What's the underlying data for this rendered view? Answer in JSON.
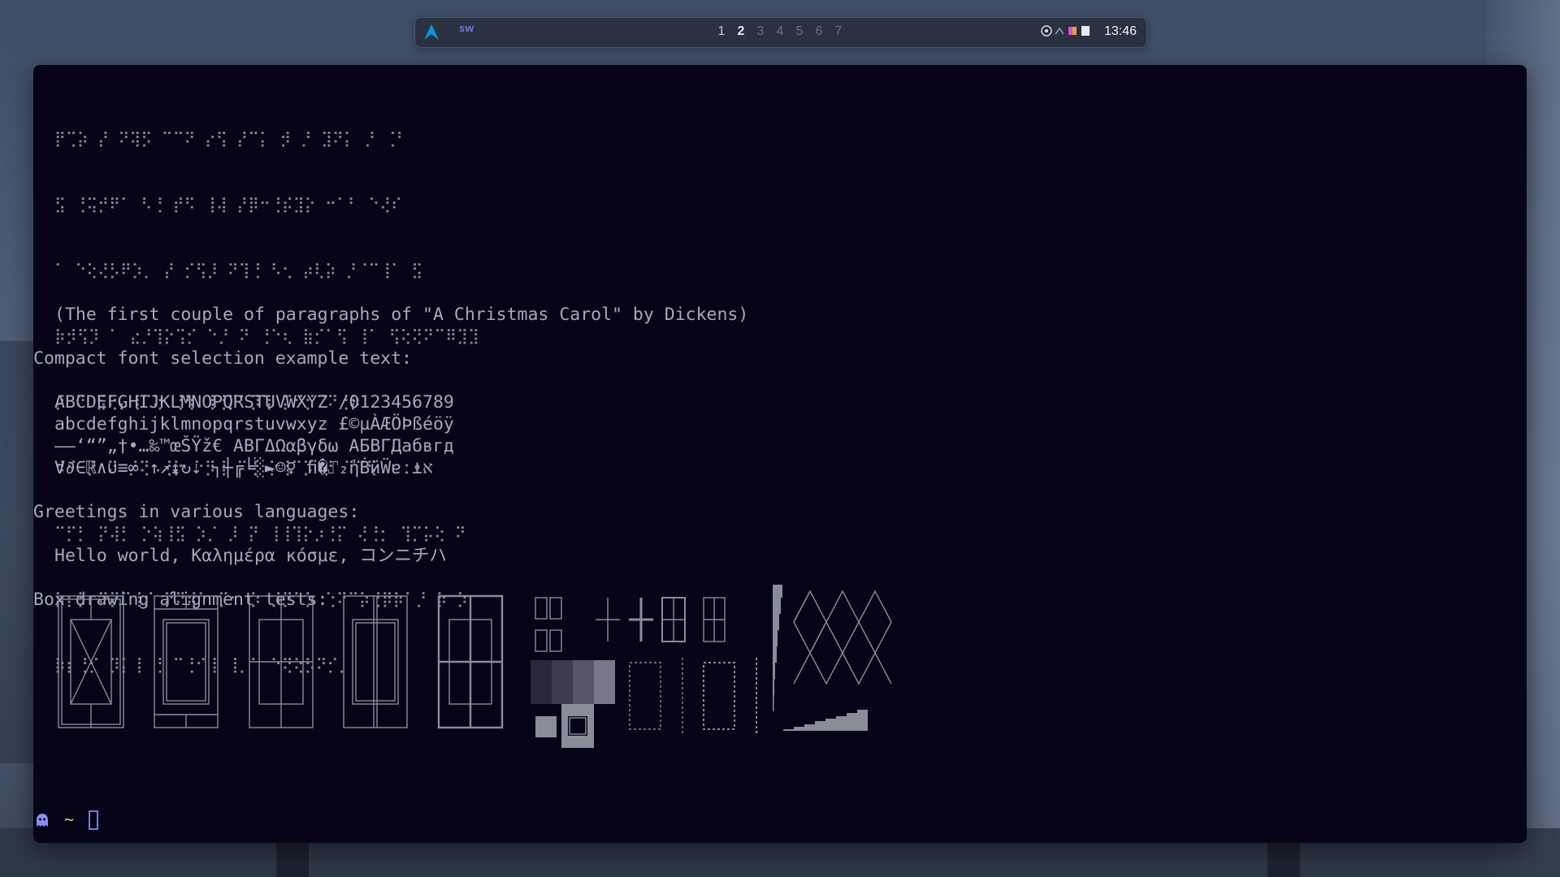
{
  "topbar": {
    "launcher_icon": "arch-logo-icon",
    "app_indicator": "SW",
    "workspaces": [
      {
        "label": "1",
        "state": "used"
      },
      {
        "label": "2",
        "state": "active"
      },
      {
        "label": "3",
        "state": "empty"
      },
      {
        "label": "4",
        "state": "empty"
      },
      {
        "label": "5",
        "state": "empty"
      },
      {
        "label": "6",
        "state": "empty"
      },
      {
        "label": "7",
        "state": "empty"
      }
    ],
    "tray_icons": [
      "dropbox-icon",
      "network-icon",
      "colorpicker-icon",
      "clipboard-icon"
    ],
    "clock": "13:46"
  },
  "terminal": {
    "braille_lines": [
      "⡟⢉⡵ ⡜ ⠝⢽⡫ ⠉⠉⠝ ⡔⢫ ⡜⠉⡅ ⡺ ⡘ ⣹⠝⡅ ⡘ ⢈⠃",
      "⣫ ⢘⢭⡚⠟⠁ ⠣⢘ ⡞⠫ ⢸⢼ ⡜⡿⠒⢘⡮⣹⡕ ⠒⠁⠃ ⠑⢜⠎",
      "⠁ ⠑⢕⢜⡣⠟⡱⡀ ⡜ ⡊⢫⡸ ⠝⢹⢘ ⠣⢂ ⡴⢇⡵ ⡘⠈⠉⢸⠁ ⣫",
      "⡷⡺⢫⡹ ⠁ ⣔⡘⢹⡕⢩⡊ ⠑⡘ ⠝ ⢘⠑⢆ ⣷⡊⠁⢫ ⢸⠁ ⢫⢕⢝⠝⠉⠿⣹⣹",
      "⡜ ⠝ ⣫⢕⡄⢸⠉⢕ ⢘⢳ ⢸⢘⡍⠁⡹⢹ ⡍⠊⡊⠉⠝⢘⡷",
      "⠺⠊ ⡘ ⠝ ⡜⢝⠢⢘⡕ ⠑⡻⢸ ⠉⢘ ⡕⢸⠉⡩ ⡜ ⠉⠉⢫",
      "⠉⡋⡃ ⡝⢼⡃ ⡑⢵⢸⣫ ⡱⡈ ⡸ ⡝ ⢸⢸⢹⡕⡰⢘⡍ ⢜⢘⡂ ⢹⡉⡥⢕ ⠝",
      "⡷⡆⡃ ⠝⡝⠉⢸⡊ ⡝⠝⢾⠁ ⡉⠂ ⡱ ⡸⡙⠁⡱ ⢑⠝⠉⡵⢘⡿⡷⠁⡘ ⡷ ⡱",
      "⡷⡆⢘⡊ ⡹⡅⢸ ⢘ ⠉⢘⠊⢸ ⢸⡀⠁ ⠑⢝⢕⡣⠝⡊⡀"
    ],
    "attribution": "(The first couple of paragraphs of \"A Christmas Carol\" by Dickens)",
    "section_font": "Compact font selection example text:",
    "font_lines": [
      "ABCDEFGHIJKLMNOPQRSTUVWXYZ /0123456789",
      "abcdefghijklmnopqrstuvwxyz £©µÀÆÖÞßéöÿ",
      "–—‘“”„†•…‰™œŠŸž€ ΑΒΓΔΩαβγδω АБВГДабвгд",
      "∀∂∈ℝ∧∪≡∞ ↑↗↨↻⇣ ┐┼╔╘░►☺♀ ﬁ�⑀₂ἠḂӥẄɐː⍎א"
    ],
    "section_greet": "Greetings in various languages:",
    "greeting": "Hello world, Καλημέρα κόσμε, コンニチハ",
    "section_box": "Box drawing alignment tests:",
    "prompt_icon": "ghost-icon",
    "prompt_dir": "~"
  }
}
